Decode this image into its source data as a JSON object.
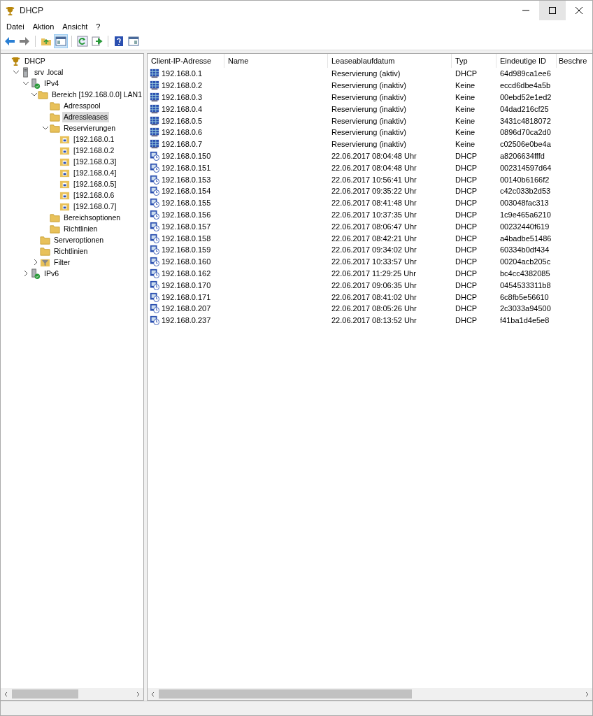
{
  "window": {
    "title": "DHCP"
  },
  "menu": [
    "Datei",
    "Aktion",
    "Ansicht",
    "?"
  ],
  "tree": [
    {
      "label": "DHCP",
      "kind": "dhcp",
      "selected": false,
      "children": [
        {
          "label": "srv .local",
          "kind": "server",
          "expanded": true,
          "selected": false,
          "children": [
            {
              "label": "IPv4",
              "kind": "protocol",
              "expanded": true,
              "selected": false,
              "children": [
                {
                  "label": "Bereich [192.168.0.0] LAN1",
                  "kind": "folder",
                  "expanded": true,
                  "selected": false,
                  "children": [
                    {
                      "label": "Adresspool",
                      "kind": "folder",
                      "selected": false
                    },
                    {
                      "label": "Adressleases",
                      "kind": "folder",
                      "selected": true
                    },
                    {
                      "label": "Reservierungen",
                      "kind": "folder",
                      "expanded": true,
                      "selected": false,
                      "children": [
                        {
                          "label": "[192.168.0.1",
                          "kind": "reservation",
                          "selected": false
                        },
                        {
                          "label": "[192.168.0.2",
                          "kind": "reservation",
                          "selected": false
                        },
                        {
                          "label": "[192.168.0.3]",
                          "kind": "reservation",
                          "selected": false
                        },
                        {
                          "label": "[192.168.0.4]",
                          "kind": "reservation",
                          "selected": false
                        },
                        {
                          "label": "[192.168.0.5]",
                          "kind": "reservation",
                          "selected": false
                        },
                        {
                          "label": "[192.168.0.6",
                          "kind": "reservation",
                          "selected": false
                        },
                        {
                          "label": "[192.168.0.7]",
                          "kind": "reservation",
                          "selected": false
                        }
                      ]
                    },
                    {
                      "label": "Bereichsoptionen",
                      "kind": "folder",
                      "selected": false
                    },
                    {
                      "label": "Richtlinien",
                      "kind": "folder",
                      "selected": false
                    }
                  ]
                },
                {
                  "label": "Serveroptionen",
                  "kind": "folder",
                  "selected": false
                },
                {
                  "label": "Richtlinien",
                  "kind": "folder",
                  "selected": false
                },
                {
                  "label": "Filter",
                  "kind": "filter",
                  "expanded": false,
                  "selected": false
                }
              ]
            },
            {
              "label": "IPv6",
              "kind": "protocol",
              "expanded": false,
              "selected": false
            }
          ]
        }
      ]
    }
  ],
  "table": {
    "columns": [
      "Client-IP-Adresse",
      "Name",
      "Leaseablaufdatum",
      "Typ",
      "Eindeutige ID",
      "Beschre"
    ],
    "rows": [
      {
        "kind": "reservation",
        "ip": "192.168.0.1",
        "lease": "Reservierung (aktiv)",
        "type": "DHCP",
        "id": "64d989ca1ee6"
      },
      {
        "kind": "reservation",
        "ip": "192.168.0.2",
        "lease": "Reservierung (inaktiv)",
        "type": "Keine",
        "id": "eccd6dbe4a5b"
      },
      {
        "kind": "reservation",
        "ip": "192.168.0.3",
        "lease": "Reservierung (inaktiv)",
        "type": "Keine",
        "id": "00ebd52e1ed2"
      },
      {
        "kind": "reservation",
        "ip": "192.168.0.4",
        "lease": "Reservierung (inaktiv)",
        "type": "Keine",
        "id": "04dad216cf25"
      },
      {
        "kind": "reservation",
        "ip": "192.168.0.5",
        "lease": "Reservierung (inaktiv)",
        "type": "Keine",
        "id": "3431c4818072"
      },
      {
        "kind": "reservation",
        "ip": "192.168.0.6",
        "lease": "Reservierung (inaktiv)",
        "type": "Keine",
        "id": "0896d70ca2d0"
      },
      {
        "kind": "reservation",
        "ip": "192.168.0.7",
        "lease": "Reservierung (inaktiv)",
        "type": "Keine",
        "id": "c02506e0be4a"
      },
      {
        "kind": "lease",
        "ip": "192.168.0.150",
        "lease": "22.06.2017 08:04:48 Uhr",
        "type": "DHCP",
        "id": "a8206634fffd"
      },
      {
        "kind": "lease",
        "ip": "192.168.0.151",
        "lease": "22.06.2017 08:04:48 Uhr",
        "type": "DHCP",
        "id": "002314597d64"
      },
      {
        "kind": "lease",
        "ip": "192.168.0.153",
        "lease": "22.06.2017 10:56:41 Uhr",
        "type": "DHCP",
        "id": "00140b6166f2"
      },
      {
        "kind": "lease",
        "ip": "192.168.0.154",
        "lease": "22.06.2017 09:35:22 Uhr",
        "type": "DHCP",
        "id": "c42c033b2d53"
      },
      {
        "kind": "lease",
        "ip": "192.168.0.155",
        "lease": "22.06.2017 08:41:48 Uhr",
        "type": "DHCP",
        "id": "003048fac313"
      },
      {
        "kind": "lease",
        "ip": "192.168.0.156",
        "lease": "22.06.2017 10:37:35 Uhr",
        "type": "DHCP",
        "id": "1c9e465a6210"
      },
      {
        "kind": "lease",
        "ip": "192.168.0.157",
        "lease": "22.06.2017 08:06:47 Uhr",
        "type": "DHCP",
        "id": "00232440f619"
      },
      {
        "kind": "lease",
        "ip": "192.168.0.158",
        "lease": "22.06.2017 08:42:21 Uhr",
        "type": "DHCP",
        "id": "a4badbe51486"
      },
      {
        "kind": "lease",
        "ip": "192.168.0.159",
        "lease": "22.06.2017 09:34:02 Uhr",
        "type": "DHCP",
        "id": "60334b0df434"
      },
      {
        "kind": "lease",
        "ip": "192.168.0.160",
        "lease": "22.06.2017 10:33:57 Uhr",
        "type": "DHCP",
        "id": "00204acb205c"
      },
      {
        "kind": "lease",
        "ip": "192.168.0.162",
        "lease": "22.06.2017 11:29:25 Uhr",
        "type": "DHCP",
        "id": "bc4cc4382085"
      },
      {
        "kind": "lease",
        "ip": "192.168.0.170",
        "lease": "22.06.2017 09:06:35 Uhr",
        "type": "DHCP",
        "id": "0454533311b8"
      },
      {
        "kind": "lease",
        "ip": "192.168.0.171",
        "lease": "22.06.2017 08:41:02 Uhr",
        "type": "DHCP",
        "id": "6c8fb5e56610"
      },
      {
        "kind": "lease",
        "ip": "192.168.0.207",
        "lease": "22.06.2017 08:05:26 Uhr",
        "type": "DHCP",
        "id": "2c3033a94500"
      },
      {
        "kind": "lease",
        "ip": "192.168.0.237",
        "lease": "22.06.2017 08:13:52 Uhr",
        "type": "DHCP",
        "id": "f41ba1d4e5e8"
      }
    ]
  }
}
